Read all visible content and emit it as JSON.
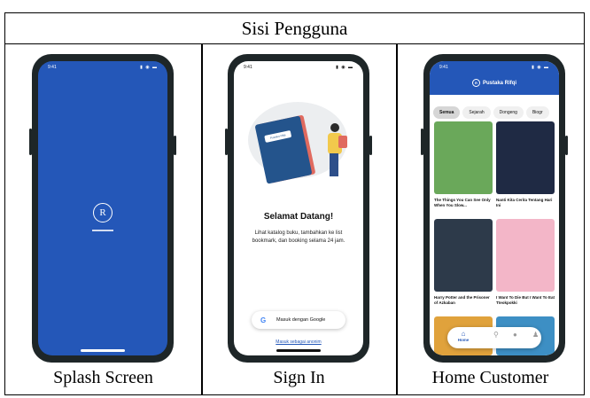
{
  "header": {
    "title": "Sisi Pengguna"
  },
  "captions": [
    "Splash Screen",
    "Sign In",
    "Home Customer"
  ],
  "status": {
    "time": "9:41",
    "signal": "▮ ◉ ▬"
  },
  "splash": {
    "logo": "R"
  },
  "signin": {
    "book_label": "Pustaka Rifqi",
    "welcome": "Selamat Datang!",
    "description": "Lihat katalog buku, tambahkan ke list bookmark, dan booking selama 24 jam.",
    "google_button": "Masuk dengan Google",
    "google_icon": "G",
    "anon_link": "Masuk sebagai anonim"
  },
  "home": {
    "brand": "Pustaka Rifqi",
    "chips": [
      "Semua",
      "Sejarah",
      "Dongeng",
      "Biogr"
    ],
    "books": [
      {
        "title": "The Things You Can See Only When You Slow...",
        "color": "#6aa85a"
      },
      {
        "title": "Nanti Kita Cerita Tentang Hari Ini",
        "color": "#1f2a44"
      },
      {
        "title": "Harry Potter and the Prisoner of Azkaban",
        "color": "#2d3a4a"
      },
      {
        "title": "I Want To Die But I Want To Eat Tteokpokki",
        "color": "#f3b6c8"
      },
      {
        "title": "",
        "color": "#e0a23c"
      },
      {
        "title": "",
        "color": "#3d8fc4"
      }
    ],
    "nav_home_label": "Home"
  },
  "colors": {
    "accent": "#2457b8",
    "frame": "#1e2628"
  }
}
